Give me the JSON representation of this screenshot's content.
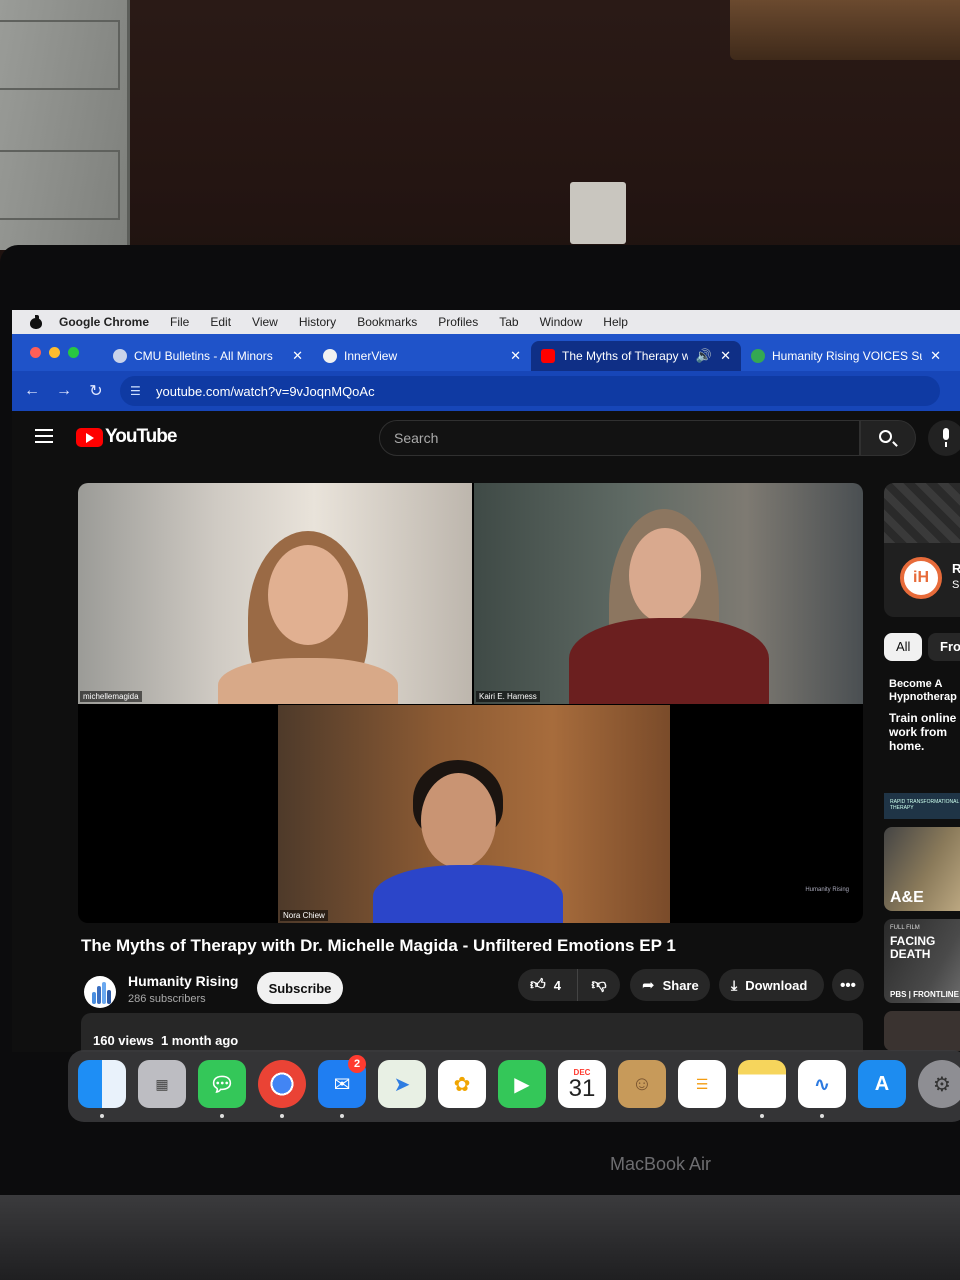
{
  "menubar": {
    "app": "Google Chrome",
    "items": [
      "File",
      "Edit",
      "View",
      "History",
      "Bookmarks",
      "Profiles",
      "Tab",
      "Window",
      "Help"
    ]
  },
  "tabs": [
    {
      "label": "CMU Bulletins - All Minors",
      "favicon_color": "#c9d3ea"
    },
    {
      "label": "InnerView",
      "favicon_color": "#f1f1f1"
    },
    {
      "label": "The Myths of Therapy wit",
      "favicon_color": "#ff0000",
      "active": true
    },
    {
      "label": "Humanity Rising VOICES Surv",
      "favicon_color": "#34a853"
    }
  ],
  "address": {
    "url": "youtube.com/watch?v=9vJoqnMQoAc"
  },
  "youtube": {
    "logo_text": "YouTube",
    "search_placeholder": "Search"
  },
  "video": {
    "participants": [
      "michellemagida",
      "Kairi E. Harness",
      "Nora Chiew"
    ],
    "watermark": "Humanity Rising",
    "title": "The Myths of Therapy with Dr. Michelle Magida - Unfiltered Emotions EP 1",
    "channel": "Humanity Rising",
    "subscribers": "286 subscribers",
    "subscribe_label": "Subscribe",
    "likes": "4",
    "share_label": "Share",
    "download_label": "Download",
    "views": "160 views",
    "age": "1 month ago"
  },
  "sidebar": {
    "ad_letter_1": "R",
    "ad_letter_2": "S",
    "chips": [
      "All",
      "Fron"
    ],
    "ad_title": "Become A Hypnotherap",
    "ad_body": "Train online work from home.",
    "ad_banner": "RAPID TRANSFORMATIONAL THERAPY",
    "thumb1_brand": "A&E",
    "thumb2_tag": "FULL FILM",
    "thumb2_title": "FACING DEATH",
    "thumb2_brand": "PBS | FRONTLINE"
  },
  "dock": {
    "mail_badge": "2",
    "calendar_month": "DEC",
    "calendar_day": "31"
  },
  "device_label": "MacBook Air",
  "colors": {
    "tab_strip": "#1f53c9",
    "address_bar": "#1746b8",
    "youtube_red": "#ff0000",
    "youtube_bg": "#0f0f0f"
  }
}
